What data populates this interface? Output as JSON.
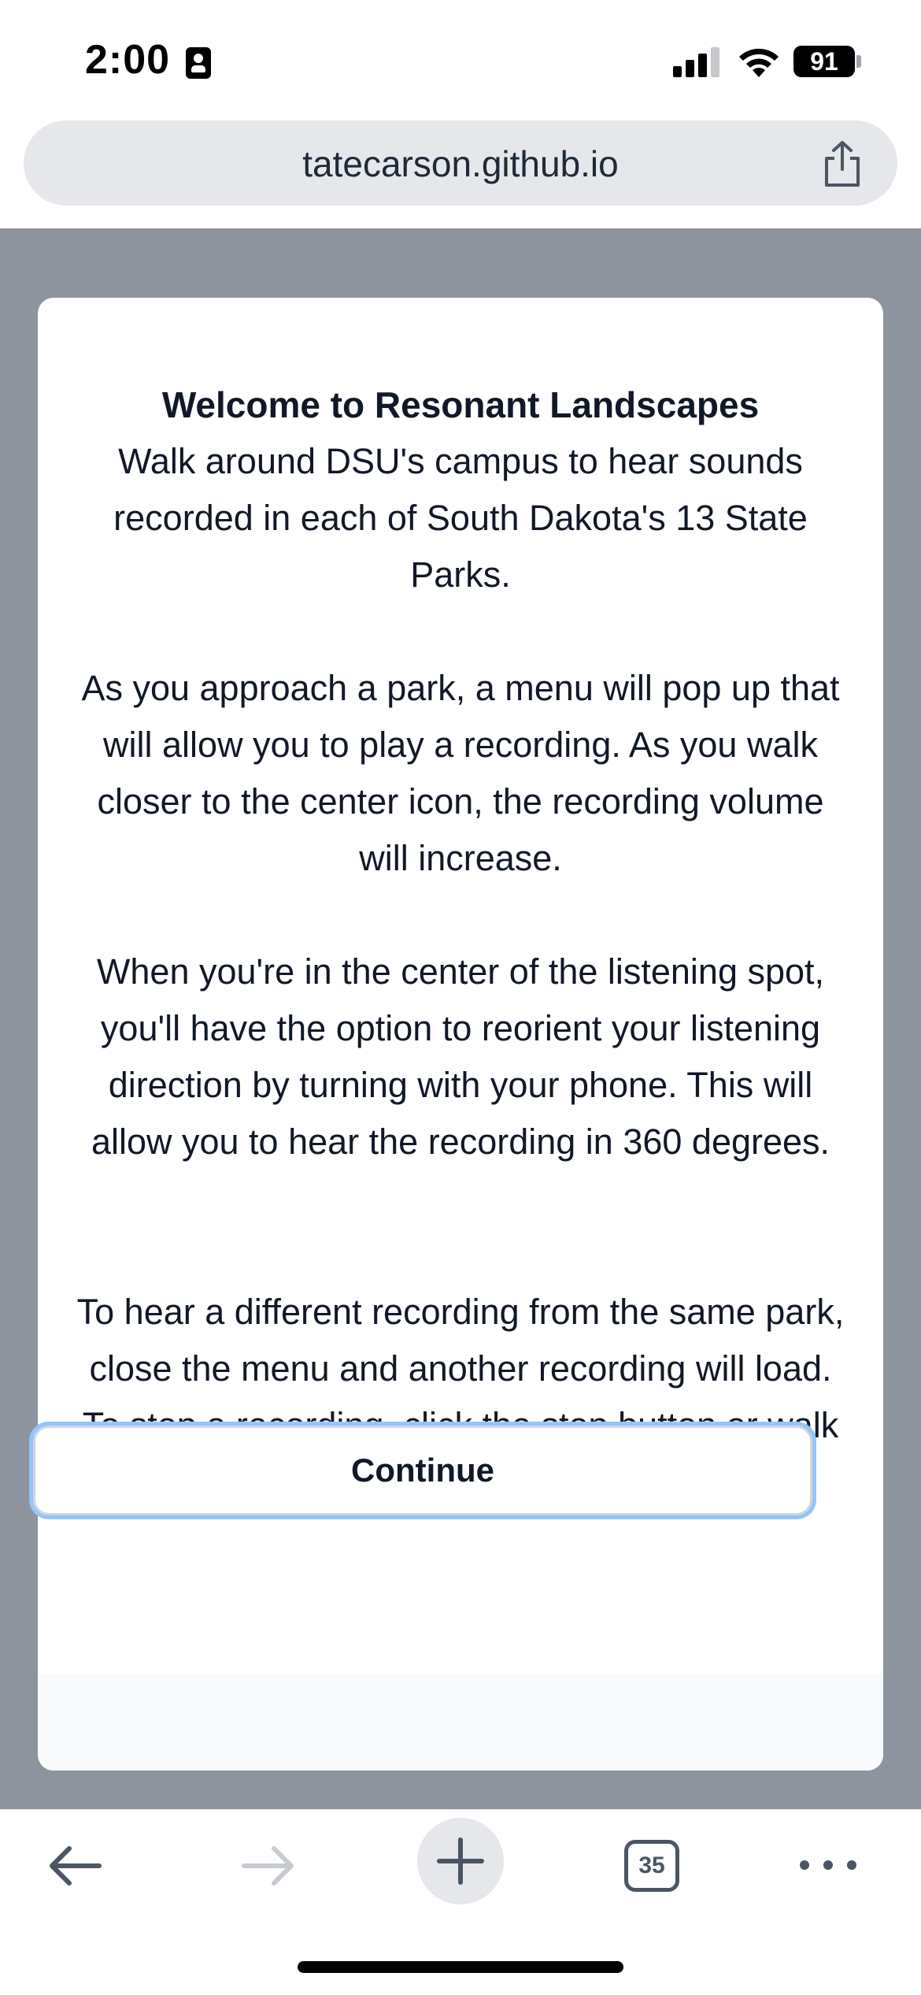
{
  "status_bar": {
    "time": "2:00",
    "battery": "91"
  },
  "browser": {
    "url": "tatecarson.github.io",
    "tab_count": "35"
  },
  "modal": {
    "title": "Welcome to Resonant Landscapes",
    "paragraphs": [
      "Walk around DSU's campus to hear sounds recorded in each of South Dakota's 13 State Parks.",
      "As you approach a park, a menu will pop up that will allow you to play a recording. As you walk closer to the center icon, the recording volume will increase.",
      "When you're in the center of the listening spot, you'll have the option to reorient your listening direction by turning with your phone. This will allow you to hear the recording in 360 degrees.",
      "To hear a different recording from the same park, close the menu and another recording will load. To stop a recording, click the stop button or walk away from the park."
    ],
    "continue_label": "Continue"
  },
  "colors": {
    "backdrop": "#8e949e",
    "focus_ring": "#93c5fd",
    "text": "#111827"
  }
}
